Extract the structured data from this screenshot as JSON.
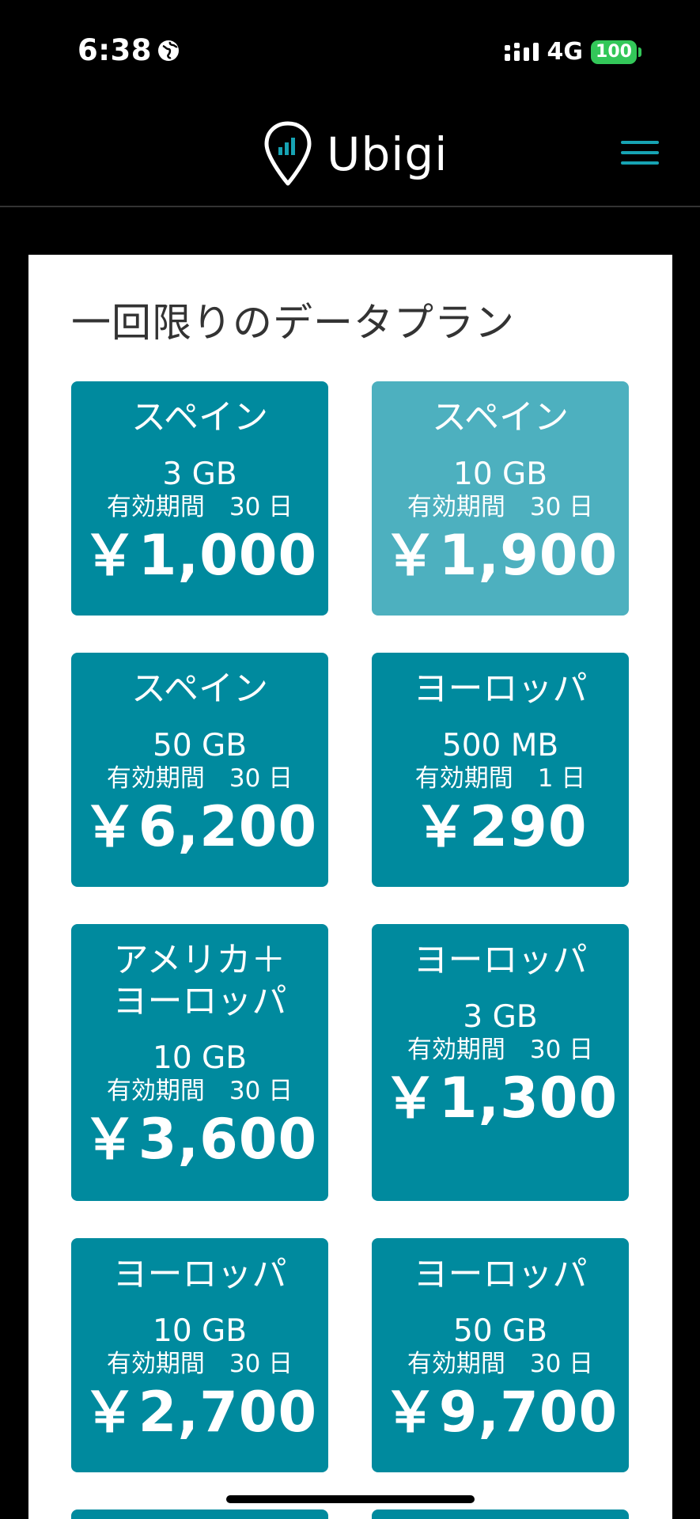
{
  "status_bar": {
    "time": "6:38",
    "network": "4G",
    "battery": "100"
  },
  "header": {
    "brand": "Ubigi"
  },
  "section": {
    "title": "一回限りのデータプラン"
  },
  "plans": [
    {
      "region": "スペイン",
      "data": "3 GB",
      "validity": "有効期間　30 日",
      "price": "￥1,000"
    },
    {
      "region": "スペイン",
      "data": "10 GB",
      "validity": "有効期間　30 日",
      "price": "￥1,900"
    },
    {
      "region": "スペイン",
      "data": "50 GB",
      "validity": "有効期間　30 日",
      "price": "￥6,200"
    },
    {
      "region": "ヨーロッパ",
      "data": "500 MB",
      "validity": "有効期間　1 日",
      "price": "￥290"
    },
    {
      "region": "アメリカ＋\nヨーロッパ",
      "data": "10 GB",
      "validity": "有効期間　30 日",
      "price": "￥3,600"
    },
    {
      "region": "ヨーロッパ",
      "data": "3 GB",
      "validity": "有効期間　30 日",
      "price": "￥1,300"
    },
    {
      "region": "ヨーロッパ",
      "data": "10 GB",
      "validity": "有効期間　30 日",
      "price": "￥2,700"
    },
    {
      "region": "ヨーロッパ",
      "data": "50 GB",
      "validity": "有効期間　30 日",
      "price": "￥9,700"
    }
  ],
  "colors": {
    "tile": "#008a9e",
    "tile_selected": "#4db0bf",
    "accent": "#17a3b3"
  }
}
